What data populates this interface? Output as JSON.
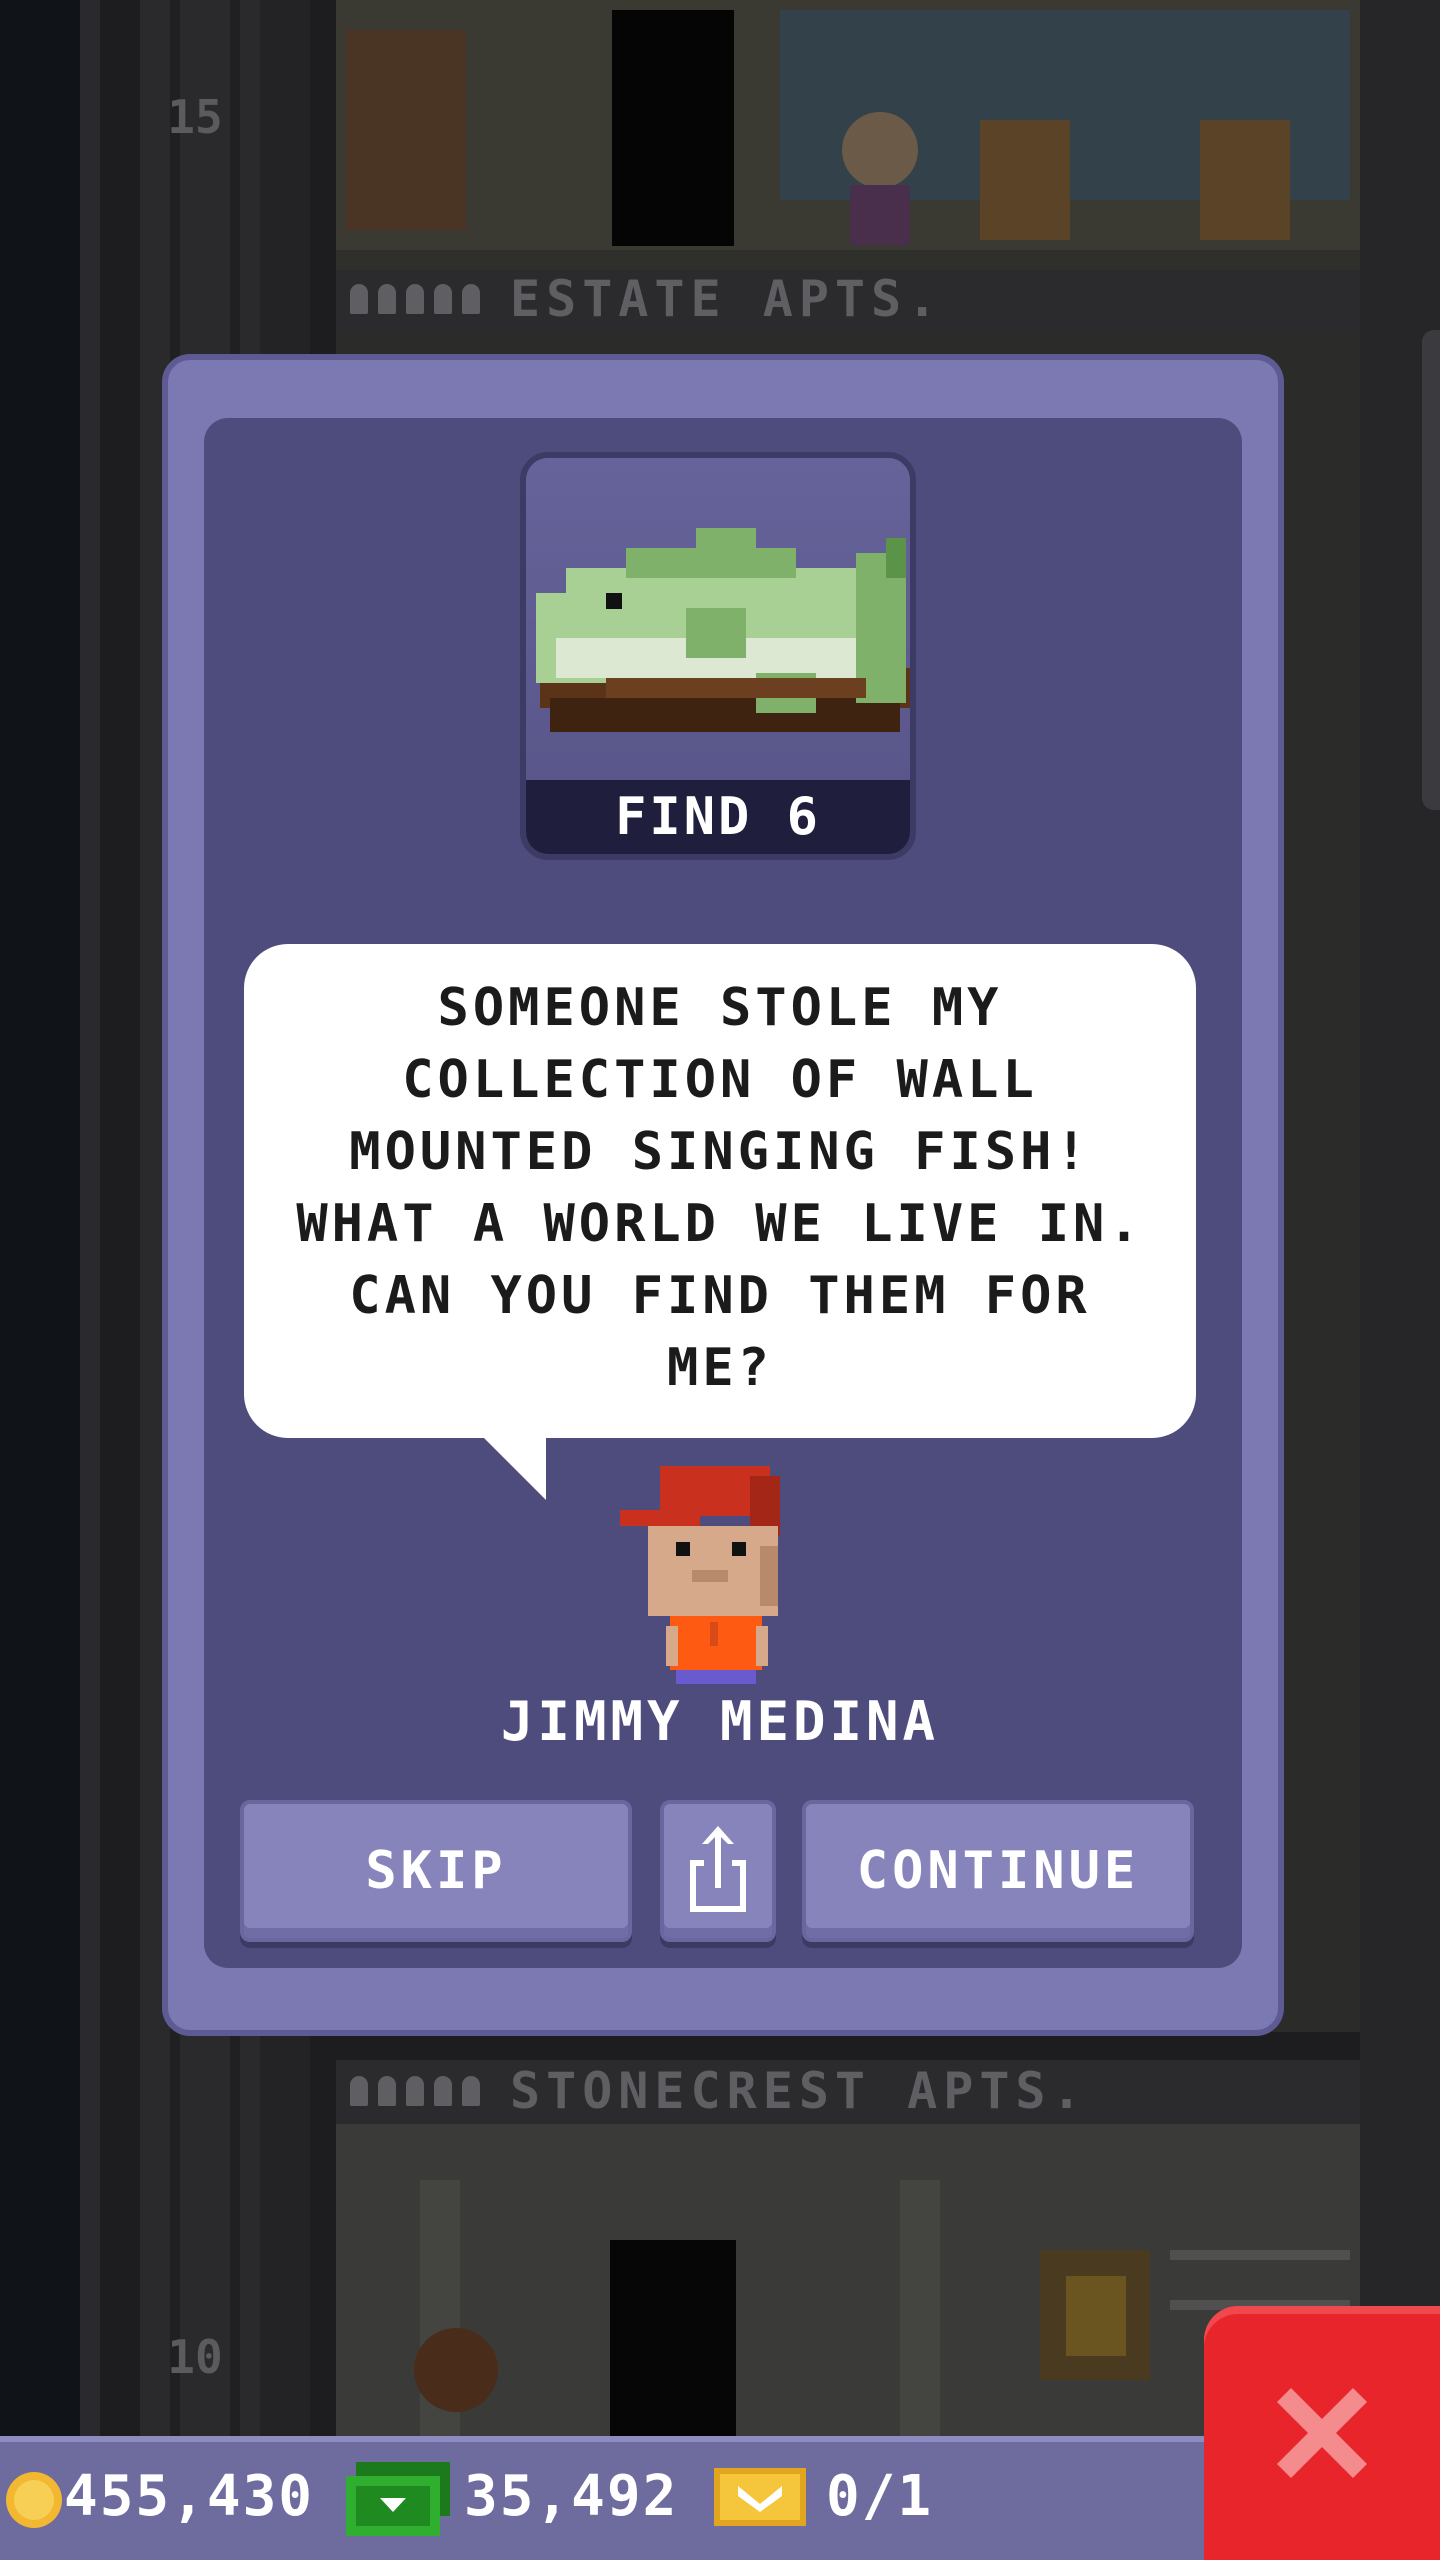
{
  "tower": {
    "floors": [
      {
        "number": "15",
        "name": "ESTATE APTS."
      },
      {
        "number": "",
        "name": "STONECREST APTS."
      },
      {
        "number": "10",
        "name": ""
      }
    ]
  },
  "dialog": {
    "mission_item": "wall-mounted-singing-fish",
    "find_label": "FIND 6",
    "message": "SOMEONE STOLE MY\nCOLLECTION OF WALL\nMOUNTED SINGING FISH!\nWHAT A WORLD WE LIVE IN.\nCAN YOU FIND THEM FOR\nME?",
    "character_name": "JIMMY MEDINA",
    "buttons": {
      "skip": "SKIP",
      "continue": "CONTINUE"
    }
  },
  "status_bar": {
    "coins": "455,430",
    "bux": "35,492",
    "tickets": "0/1"
  },
  "colors": {
    "dialog_frame": "#7b78b2",
    "dialog_panel": "#4e4b7d",
    "close_button": "#e8252b",
    "status_bar": "#6e6b9f"
  }
}
